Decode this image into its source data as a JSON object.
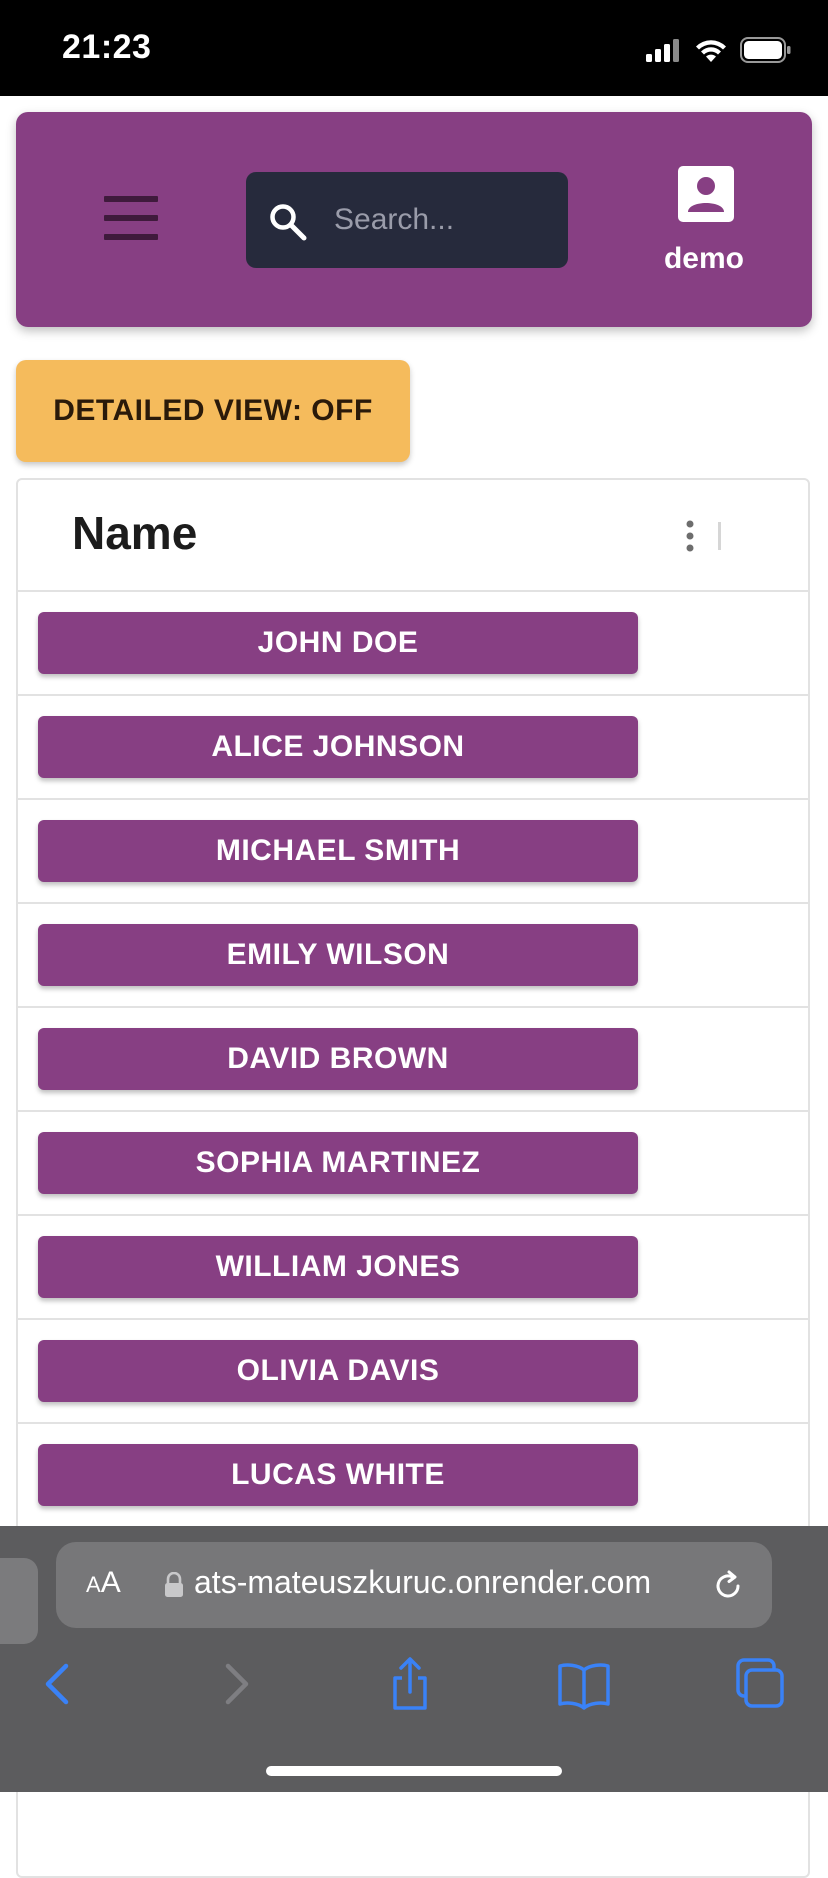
{
  "status_bar": {
    "time": "21:23",
    "icons": [
      "cellular-signal-icon",
      "wifi-icon",
      "battery-icon"
    ]
  },
  "app_bar": {
    "background": "#873f83",
    "menu_icon": "hamburger-menu-icon",
    "search": {
      "placeholder": "Search...",
      "value": "",
      "icon": "search-icon",
      "background": "#262a3c"
    },
    "user": {
      "icon": "account-box-icon",
      "name": "demo"
    }
  },
  "detail_toggle": {
    "label": "DETAILED VIEW: OFF",
    "background": "#f5bb5c"
  },
  "grid": {
    "column_header": "Name",
    "column_menu_icon": "vertical-ellipsis-icon",
    "rows": [
      "JOHN DOE",
      "ALICE JOHNSON",
      "MICHAEL SMITH",
      "EMILY WILSON",
      "DAVID BROWN",
      "SOPHIA MARTINEZ",
      "WILLIAM JONES",
      "OLIVIA DAVIS",
      "LUCAS WHITE"
    ]
  },
  "browser": {
    "text_size_label_small": "A",
    "text_size_label_big": "A",
    "url": "ats-mateuszkuruc.onrender.com",
    "accent": "#3a82f7",
    "icons": [
      "lock-icon",
      "reload-icon",
      "back-icon",
      "forward-icon",
      "share-icon",
      "bookmarks-icon",
      "tabs-icon"
    ]
  }
}
